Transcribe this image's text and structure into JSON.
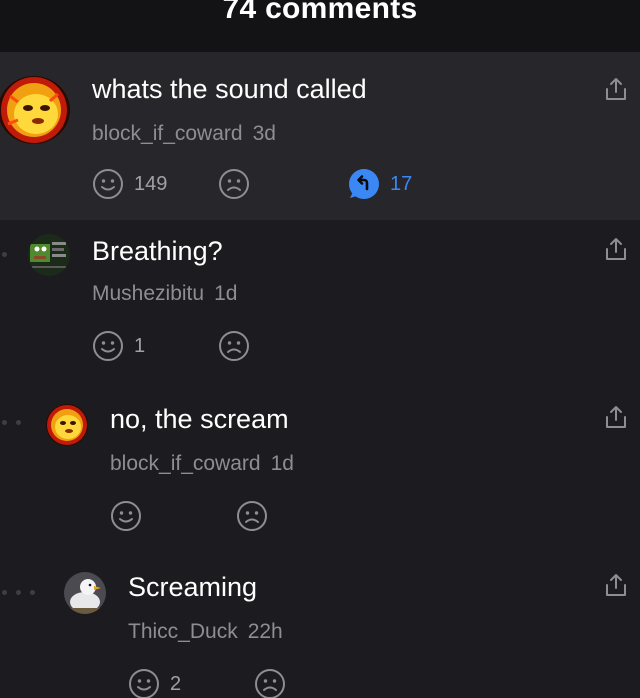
{
  "header": {
    "title": "74 comments"
  },
  "comments": [
    {
      "text": "whats the sound called",
      "user": "block_if_coward",
      "time": "3d",
      "likes": "149",
      "replies": "17",
      "avatar_icon": "doge-avatar-icon"
    },
    {
      "text": "Breathing?",
      "user": "Mushezibitu",
      "time": "1d",
      "likes": "1",
      "avatar_icon": "pepe-avatar-icon"
    },
    {
      "text": "no, the scream",
      "user": "block_if_coward",
      "time": "1d",
      "likes": "",
      "avatar_icon": "doge-avatar-icon"
    },
    {
      "text": "Screaming",
      "user": "Thicc_Duck",
      "time": "22h",
      "likes": "2",
      "avatar_icon": "duck-avatar-icon"
    }
  ],
  "icons": {
    "upvote": "smile-face-icon",
    "downvote": "frown-face-icon",
    "reply": "reply-bubble-icon",
    "share": "share-upload-icon"
  },
  "colors": {
    "background": "#1c1c20",
    "highlight": "#27272b",
    "header": "#131315",
    "accent": "#3b88f5",
    "meta": "#8d8d92"
  }
}
